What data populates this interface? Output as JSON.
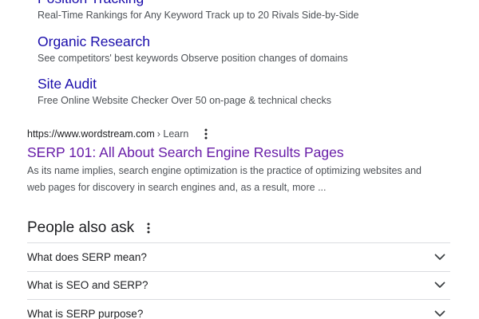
{
  "sitelinks": [
    {
      "title": "Position Tracking",
      "description": "Real-Time Rankings for Any Keyword Track up to 20 Rivals Side-by-Side"
    },
    {
      "title": "Organic Research",
      "description": "See competitors' best keywords Observe position changes of domains"
    },
    {
      "title": "Site Audit",
      "description": "Free Online Website Checker Over 50 on-page & technical checks"
    }
  ],
  "result": {
    "url": "https://www.wordstream.com",
    "breadcrumb": "› Learn",
    "title": "SERP 101: All About Search Engine Results Pages",
    "snippet": "As its name implies, search engine optimization is the practice of optimizing websites and web pages for discovery in search engines and, as a result, more ..."
  },
  "people_also_ask": {
    "title": "People also ask",
    "questions": [
      "What does SERP mean?",
      "What is SEO and SERP?",
      "What is SERP purpose?"
    ]
  },
  "icons": {
    "more": "more-vert-icon",
    "expand": "chevron-down-icon"
  },
  "colors": {
    "link": "#1a0dab",
    "visited": "#681da8",
    "text": "#202124",
    "secondary_text": "#4d5156",
    "divider": "#dadce0"
  }
}
